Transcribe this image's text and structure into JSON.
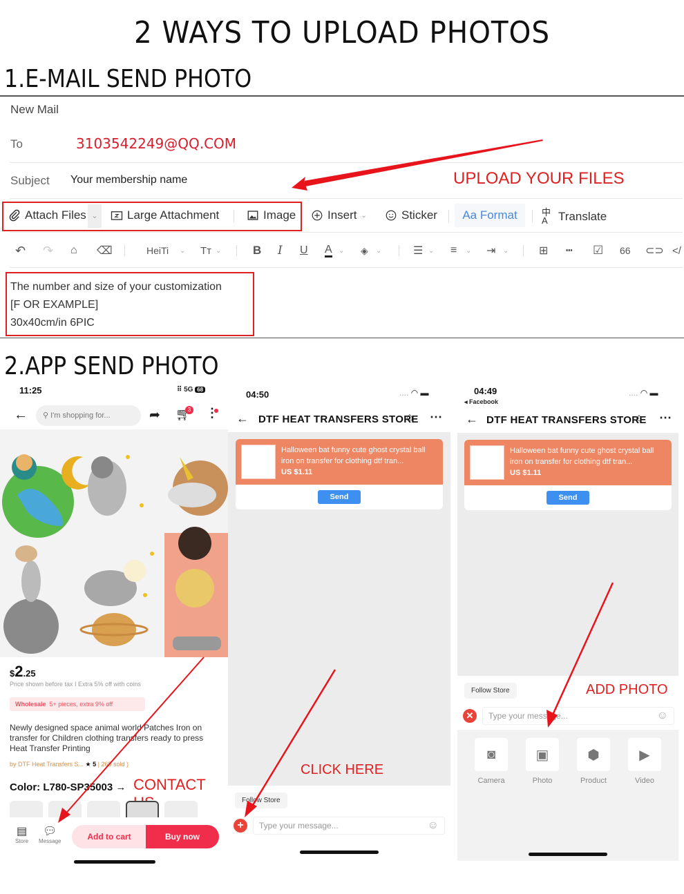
{
  "page": {
    "title": "2 WAYS TO UPLOAD PHOTOS",
    "section1_title": "1.E-MAIL SEND PHOTO",
    "section2_title": "2.APP SEND PHOTO"
  },
  "email": {
    "window_title": "New Mail",
    "to_label": "To",
    "to_value": "3103542249@QQ.COM",
    "subject_label": "Subject",
    "subject_value": "Your membership name",
    "annotation": "UPLOAD YOUR FILES",
    "toolbar": {
      "attach_files": "Attach Files",
      "large_attachment": "Large Attachment",
      "image": "Image",
      "insert": "Insert",
      "sticker": "Sticker",
      "format": "Aa Format",
      "translate": "Translate"
    },
    "format_bar": {
      "font": "HeiTi",
      "size": "Tт",
      "quote": "66"
    },
    "body_lines": [
      "The number and size of your  customization",
      "[F OR EXAMPLE]",
      "30x40cm/in  6PIC"
    ]
  },
  "phone1": {
    "time": "11:25",
    "signal": "5G",
    "battery": "68",
    "search_placeholder": "I'm shopping for...",
    "cart_count": "3",
    "price_symbol": "$",
    "price_main": "2",
    "price_cents": ".25",
    "price_note": "Price shown before tax I Extra 5% off with coins",
    "wholesale_tag": "Wholesale",
    "wholesale_text": "5+ pieces, extra 9% off",
    "product_title": "Newly designed space animal world Patches Iron on transfer for Children clothing transfers ready to press Heat Transfer Printing",
    "seller": "by DTF Heat Transfers S...",
    "rating": "5",
    "sold": "| 265 sold )",
    "color_label": "Color: L780-SP35003 →",
    "annotation": "CONTACT US",
    "store_label": "Store",
    "message_label": "Message",
    "add_to_cart": "Add to cart",
    "buy_now": "Buy now",
    "colors": {
      "primary": "#f02d4a",
      "light": "#fde3e6"
    }
  },
  "phone2": {
    "time": "04:50",
    "store_title": "DTF HEAT TRANSFERS STORE",
    "product_text": "Halloween bat funny cute ghost crystal ball iron on transfer for clothing dtf tran...",
    "product_price": "US $1.11",
    "send_label": "Send",
    "annotation": "CLICK HERE",
    "follow_store": "Follow Store",
    "message_placeholder": "Type your message..."
  },
  "phone3": {
    "time": "04:49",
    "back_app": "◂ Facebook",
    "store_title": "DTF HEAT TRANSFERS STORE",
    "product_text": "Halloween bat funny cute ghost crystal ball iron on transfer for clothing dtf tran...",
    "product_price": "US $1.11",
    "send_label": "Send",
    "follow_store": "Follow Store",
    "annotation": "ADD PHOTO",
    "message_placeholder": "Type your message...",
    "attach_options": [
      {
        "label": "Camera",
        "icon": "camera-icon"
      },
      {
        "label": "Photo",
        "icon": "photo-icon"
      },
      {
        "label": "Product",
        "icon": "box-icon"
      },
      {
        "label": "Video",
        "icon": "play-icon"
      }
    ]
  },
  "colors": {
    "annotation_red": "#e02020",
    "product_card": "#ee8663",
    "send_blue": "#3d8ff0",
    "format_blue": "#4a88d9"
  }
}
